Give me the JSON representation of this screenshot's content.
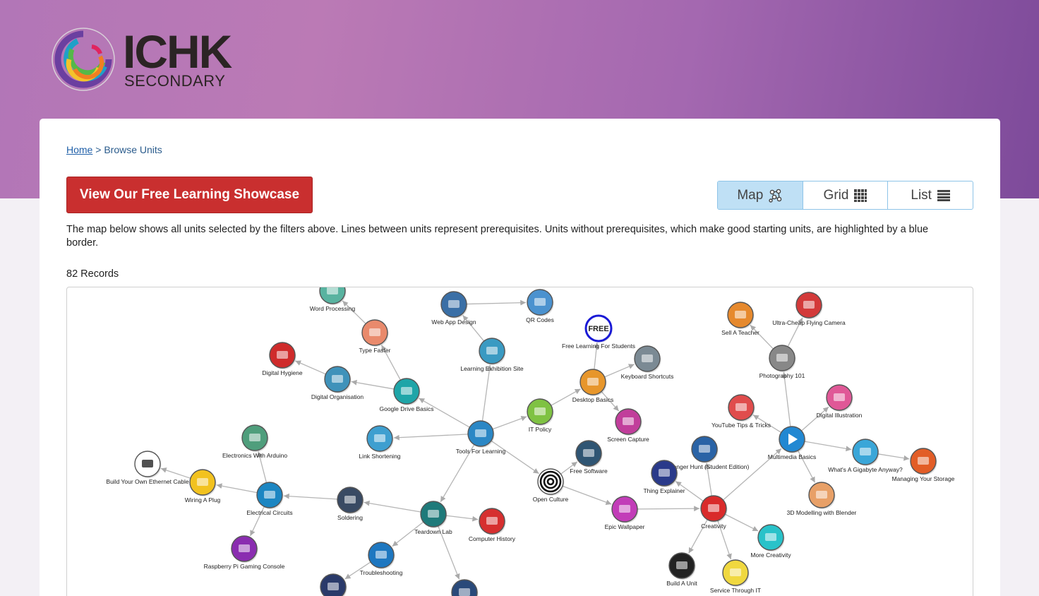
{
  "logo": {
    "title": "ICHK",
    "subtitle": "SECONDARY"
  },
  "breadcrumb": {
    "home": "Home",
    "separator": " > ",
    "current": "Browse Units"
  },
  "showcase_button": "View Our Free Learning Showcase",
  "views": [
    {
      "label": "Map",
      "icon": "map-network-icon",
      "active": true
    },
    {
      "label": "Grid",
      "icon": "grid-icon",
      "active": false
    },
    {
      "label": "List",
      "icon": "list-icon",
      "active": false
    }
  ],
  "description": "The map below shows all units selected by the filters above. Lines between units represent prerequisites. Units without prerequisites, which make good starting units, are highlighted by a blue border.",
  "records": "82 Records",
  "colors": {
    "accent": "#c92f2f",
    "toggle_active": "#bfe0f5",
    "link": "#1f5fa8",
    "start_border": "#1a1ad6"
  },
  "nodes": [
    {
      "id": "word",
      "label": "Word Processing",
      "color": "#59b3a0"
    },
    {
      "id": "webapp",
      "label": "Web App Design",
      "color": "#3a6fa6"
    },
    {
      "id": "qr",
      "label": "QR Codes",
      "color": "#4b92cf"
    },
    {
      "id": "typefaster",
      "label": "Type Faster",
      "color": "#e98a6c"
    },
    {
      "id": "freelearn",
      "label": "Free Learning For Students",
      "color": "#ffffff",
      "start": true,
      "badge": "FREE"
    },
    {
      "id": "sellteacher",
      "label": "Sell A Teacher",
      "color": "#e6892d"
    },
    {
      "id": "flyingcam",
      "label": "Ultra-Cheap Flying Camera",
      "color": "#d33a3a"
    },
    {
      "id": "hygiene",
      "label": "Digital Hygiene",
      "color": "#cf2b2b"
    },
    {
      "id": "exhibition",
      "label": "Learning Exhibition Site",
      "color": "#3a9ac2"
    },
    {
      "id": "keyboard",
      "label": "Keyboard Shortcuts",
      "color": "#7b8a94"
    },
    {
      "id": "photo101",
      "label": "Photography 101",
      "color": "#888888"
    },
    {
      "id": "organisation",
      "label": "Digital Organisation",
      "color": "#3f92ba"
    },
    {
      "id": "gdrive",
      "label": "Google Drive Basics",
      "color": "#1fa5a8"
    },
    {
      "id": "desktop",
      "label": "Desktop Basics",
      "color": "#e7962b"
    },
    {
      "id": "itpolicy",
      "label": "IT Policy",
      "color": "#7fc243"
    },
    {
      "id": "screencap",
      "label": "Screen Capture",
      "color": "#c13e9b"
    },
    {
      "id": "illustration",
      "label": "Digital Illustration",
      "color": "#e05897"
    },
    {
      "id": "youtube",
      "label": "YouTube Tips & Tricks",
      "color": "#e04c4c"
    },
    {
      "id": "arduino",
      "label": "Electronics With Arduino",
      "color": "#4f9e7c"
    },
    {
      "id": "linkshort",
      "label": "Link Shortening",
      "color": "#3e9fd0"
    },
    {
      "id": "tools",
      "label": "Tools For Learning",
      "color": "#2b87c5"
    },
    {
      "id": "freesoft",
      "label": "Free Software",
      "color": "#2f5573"
    },
    {
      "id": "scavenger",
      "label": "Scavenger Hunt (Student Edition)",
      "color": "#2a63a6"
    },
    {
      "id": "multimedia",
      "label": "Multimedia Basics",
      "color": "#2288d2"
    },
    {
      "id": "gigabyte",
      "label": "What's A Gigabyte Anyway?",
      "color": "#3aa6d8"
    },
    {
      "id": "storage",
      "label": "Managing Your Storage",
      "color": "#e25d27"
    },
    {
      "id": "ethernet",
      "label": "Build Your Own Ethernet Cable",
      "color": "#ffffff"
    },
    {
      "id": "wiring",
      "label": "Wiring A Plug",
      "color": "#f2c21f"
    },
    {
      "id": "thing",
      "label": "Thing Explainer",
      "color": "#2a3a8a"
    },
    {
      "id": "opencult",
      "label": "Open Culture",
      "color": "#ffffff"
    },
    {
      "id": "circuits",
      "label": "Electrical Circuits",
      "color": "#1c86c2"
    },
    {
      "id": "soldering",
      "label": "Soldering",
      "color": "#394a63"
    },
    {
      "id": "epic",
      "label": "Epic Wallpaper",
      "color": "#c23db8"
    },
    {
      "id": "creativity",
      "label": "Creativity",
      "color": "#d92b2b"
    },
    {
      "id": "blender",
      "label": "3D Modelling with Blender",
      "color": "#e8a067"
    },
    {
      "id": "teardown",
      "label": "Teardown Lab",
      "color": "#1f7a7a"
    },
    {
      "id": "comphist",
      "label": "Computer History",
      "color": "#d62f2f"
    },
    {
      "id": "raspberry",
      "label": "Raspberry Pi Gaming Console",
      "color": "#8a2db0"
    },
    {
      "id": "morecreat",
      "label": "More Creativity",
      "color": "#29c2c9"
    },
    {
      "id": "trouble",
      "label": "Troubleshooting",
      "color": "#1e77c0"
    },
    {
      "id": "buildunit",
      "label": "Build A Unit",
      "color": "#222222"
    },
    {
      "id": "service",
      "label": "Service Through IT",
      "color": "#f0d840"
    },
    {
      "id": "bottom1",
      "label": "",
      "color": "#2a3a6a"
    },
    {
      "id": "bottom2",
      "label": "",
      "color": "#2a4a7a"
    }
  ],
  "edges": [
    [
      "typefaster",
      "word"
    ],
    [
      "gdrive",
      "typefaster"
    ],
    [
      "gdrive",
      "organisation"
    ],
    [
      "organisation",
      "hygiene"
    ],
    [
      "tools",
      "gdrive"
    ],
    [
      "tools",
      "linkshort"
    ],
    [
      "tools",
      "exhibition"
    ],
    [
      "exhibition",
      "webapp"
    ],
    [
      "tools",
      "itpolicy"
    ],
    [
      "itpolicy",
      "desktop"
    ],
    [
      "desktop",
      "freelearn"
    ],
    [
      "desktop",
      "keyboard"
    ],
    [
      "desktop",
      "screencap"
    ],
    [
      "tools",
      "opencult"
    ],
    [
      "opencult",
      "freesoft"
    ],
    [
      "opencult",
      "epic"
    ],
    [
      "tools",
      "teardown"
    ],
    [
      "teardown",
      "comphist"
    ],
    [
      "teardown",
      "soldering"
    ],
    [
      "teardown",
      "trouble"
    ],
    [
      "teardown",
      "bottom2"
    ],
    [
      "soldering",
      "circuits"
    ],
    [
      "circuits",
      "arduino"
    ],
    [
      "circuits",
      "wiring"
    ],
    [
      "wiring",
      "ethernet"
    ],
    [
      "circuits",
      "raspberry"
    ],
    [
      "trouble",
      "bottom1"
    ],
    [
      "epic",
      "creativity"
    ],
    [
      "creativity",
      "thing"
    ],
    [
      "creativity",
      "scavenger"
    ],
    [
      "creativity",
      "multimedia"
    ],
    [
      "creativity",
      "morecreat"
    ],
    [
      "creativity",
      "buildunit"
    ],
    [
      "creativity",
      "service"
    ],
    [
      "multimedia",
      "youtube"
    ],
    [
      "multimedia",
      "illustration"
    ],
    [
      "multimedia",
      "photo101"
    ],
    [
      "multimedia",
      "gigabyte"
    ],
    [
      "multimedia",
      "blender"
    ],
    [
      "gigabyte",
      "storage"
    ],
    [
      "photo101",
      "sellteacher"
    ],
    [
      "photo101",
      "flyingcam"
    ],
    [
      "webapp",
      "qr"
    ]
  ]
}
